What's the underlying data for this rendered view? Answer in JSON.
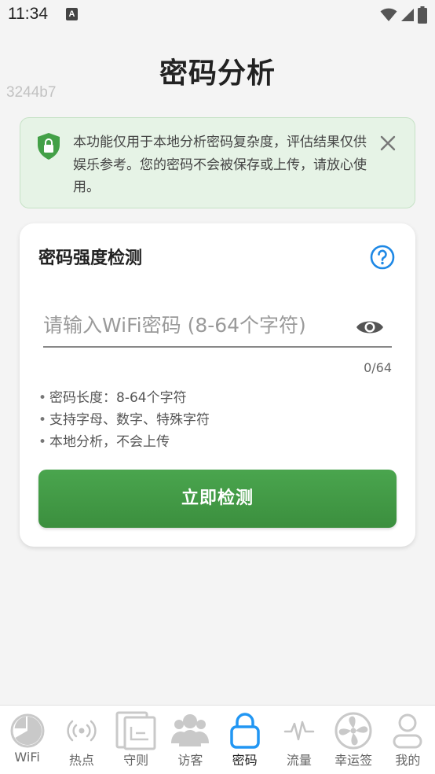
{
  "status_bar": {
    "time": "11:34",
    "notif_badge": "A"
  },
  "header": {
    "title": "密码分析",
    "build_id": "3244b7"
  },
  "notice": {
    "text": "本功能仅用于本地分析密码复杂度，评估结果仅供娱乐参考。您的密码不会被保存或上传，请放心使用。",
    "icon": "shield-lock-icon",
    "close_icon": "close-icon"
  },
  "card": {
    "title": "密码强度检测",
    "help_icon": "help-icon",
    "input": {
      "value": "",
      "placeholder": "请输入WiFi密码 (8-64个字符)"
    },
    "counter": "0/64",
    "hints": [
      "密码长度：8-64个字符",
      "支持字母、数字、特殊字符",
      "本地分析，不会上传"
    ],
    "button_label": "立即检测"
  },
  "colors": {
    "accent_green": "#43a047",
    "help_blue": "#1e88e5",
    "active_nav_blue": "#2196f3"
  },
  "nav": {
    "active_index": 4,
    "items": [
      {
        "label": "WiFi",
        "icon": "pie-chart-icon"
      },
      {
        "label": "热点",
        "icon": "hotspot-icon"
      },
      {
        "label": "守则",
        "icon": "document-icon"
      },
      {
        "label": "访客",
        "icon": "users-icon"
      },
      {
        "label": "密码",
        "icon": "lock-icon"
      },
      {
        "label": "流量",
        "icon": "waveform-icon"
      },
      {
        "label": "幸运签",
        "icon": "fan-icon"
      },
      {
        "label": "我的",
        "icon": "user-icon"
      }
    ]
  }
}
